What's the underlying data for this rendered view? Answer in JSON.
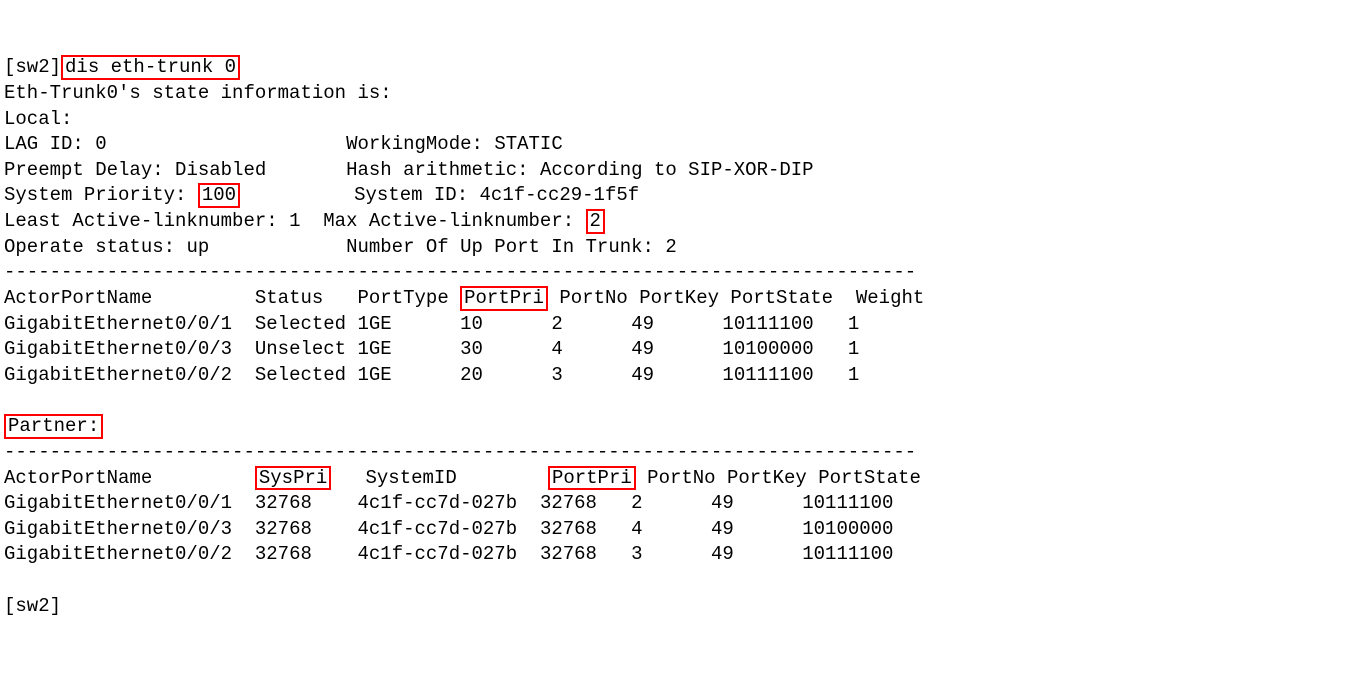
{
  "prompt_prefix": "[sw2]",
  "command": "dis eth-trunk 0",
  "header_line": "Eth-Trunk0's state information is:",
  "local_label": "Local:",
  "lag_id_label": "LAG ID:",
  "lag_id_value": "0",
  "working_mode_label": "WorkingMode:",
  "working_mode_value": "STATIC",
  "preempt_label": "Preempt Delay:",
  "preempt_value": "Disabled",
  "hash_label": "Hash arithmetic:",
  "hash_value": "According to SIP-XOR-DIP",
  "sys_pri_label": "System Priority:",
  "sys_pri_value": "100",
  "sys_id_label": "System ID:",
  "sys_id_value": "4c1f-cc29-1f5f",
  "least_active_label": "Least Active-linknumber:",
  "least_active_value": "1",
  "max_active_label": "Max Active-linknumber:",
  "max_active_value": "2",
  "operate_label": "Operate status:",
  "operate_value": "up",
  "num_up_label": "Number Of Up Port In Trunk:",
  "num_up_value": "2",
  "separator": "--------------------------------------------------------------------------------",
  "local_headers": {
    "actor": "ActorPortName",
    "status": "Status",
    "porttype": "PortType",
    "portpri": "PortPri",
    "portno": "PortNo",
    "portkey": "PortKey",
    "portstate": "PortState",
    "weight": "Weight"
  },
  "local_rows": [
    {
      "name": "GigabitEthernet0/0/1",
      "status": "Selected",
      "type": "1GE",
      "pri": "10",
      "no": "2",
      "key": "49",
      "state": "10111100",
      "weight": "1"
    },
    {
      "name": "GigabitEthernet0/0/3",
      "status": "Unselect",
      "type": "1GE",
      "pri": "30",
      "no": "4",
      "key": "49",
      "state": "10100000",
      "weight": "1"
    },
    {
      "name": "GigabitEthernet0/0/2",
      "status": "Selected",
      "type": "1GE",
      "pri": "20",
      "no": "3",
      "key": "49",
      "state": "10111100",
      "weight": "1"
    }
  ],
  "partner_label": "Partner:",
  "partner_headers": {
    "actor": "ActorPortName",
    "syspri": "SysPri",
    "systemid": "SystemID",
    "portpri": "PortPri",
    "portno": "PortNo",
    "portkey": "PortKey",
    "portstate": "PortState"
  },
  "partner_rows": [
    {
      "name": "GigabitEthernet0/0/1",
      "syspri": "32768",
      "sysid": "4c1f-cc7d-027b",
      "pri": "32768",
      "no": "2",
      "key": "49",
      "state": "10111100"
    },
    {
      "name": "GigabitEthernet0/0/3",
      "syspri": "32768",
      "sysid": "4c1f-cc7d-027b",
      "pri": "32768",
      "no": "4",
      "key": "49",
      "state": "10100000"
    },
    {
      "name": "GigabitEthernet0/0/2",
      "syspri": "32768",
      "sysid": "4c1f-cc7d-027b",
      "pri": "32768",
      "no": "3",
      "key": "49",
      "state": "10111100"
    }
  ],
  "prompt_end": "[sw2]"
}
